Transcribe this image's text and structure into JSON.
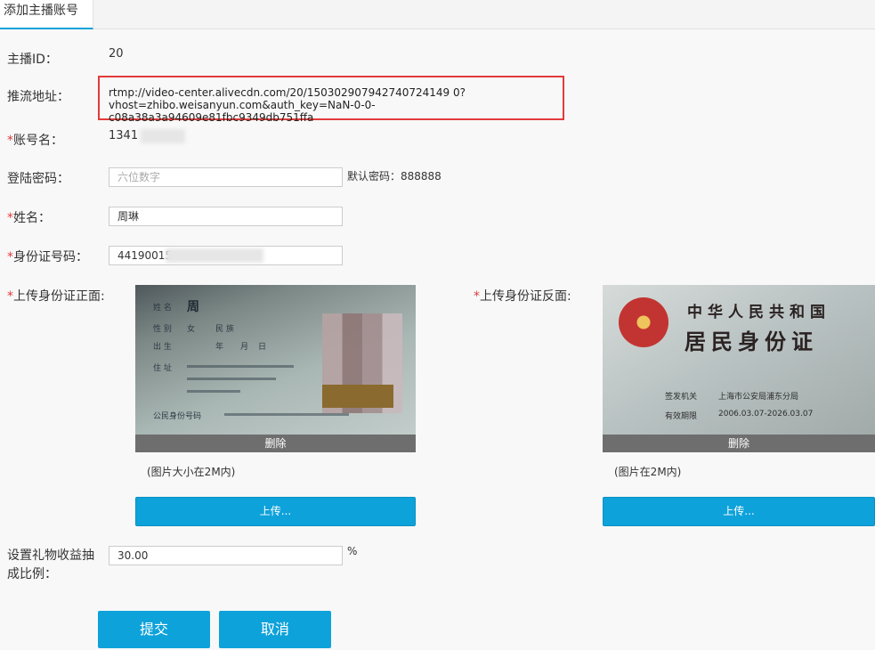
{
  "tab": {
    "label": "添加主播账号"
  },
  "fields": {
    "anchor_id": {
      "label": "主播ID：",
      "value": "20"
    },
    "push_url": {
      "label": "推流地址：",
      "line1": "rtmp://video-center.alivecdn.com/20/150302907942740724149 0?",
      "line2": "vhost=zhibo.weisanyun.com&auth_key=NaN-0-0-c08a38a3a94609e81fbc9349db751ffa"
    },
    "account_name": {
      "required_mark": "*",
      "label": "账号名：",
      "value": "1341"
    },
    "password": {
      "label": "登陆密码：",
      "placeholder": "六位数字",
      "hint": "默认密码：888888"
    },
    "name": {
      "required_mark": "*",
      "label": "姓名：",
      "value": "周琳"
    },
    "id_number": {
      "required_mark": "*",
      "label": "身份证号码：",
      "value": "44190015"
    }
  },
  "upload_front": {
    "required_mark": "*",
    "label": "上传身份证正面:",
    "delete_label": "删除",
    "note": "(图片大小在2M内)",
    "upload_label": "上传...",
    "card_texts": [
      "姓 名",
      "周",
      "性 别",
      "女",
      "民 族",
      "出 生",
      "年",
      "月",
      "日",
      "住 址",
      "公民身份号码"
    ]
  },
  "upload_back": {
    "required_mark": "*",
    "label": "上传身份证反面:",
    "delete_label": "删除",
    "note": "(图片在2M内)",
    "upload_label": "上传...",
    "title1": "中华人民共和国",
    "title2": "居民身份证",
    "authority_label": "签发机关",
    "authority_value": "上海市公安局浦东分局",
    "validity_label": "有效期限",
    "validity_value": "2006.03.07-2026.03.07"
  },
  "commission": {
    "label_line1": "设置礼物收益抽",
    "label_line2": "成比例：",
    "value": "30.00",
    "unit": "%"
  },
  "actions": {
    "submit": "提交",
    "cancel": "取消"
  },
  "colors": {
    "accent": "#0ea2da",
    "required": "#e4393c",
    "highlight_border": "#e23b3b"
  }
}
